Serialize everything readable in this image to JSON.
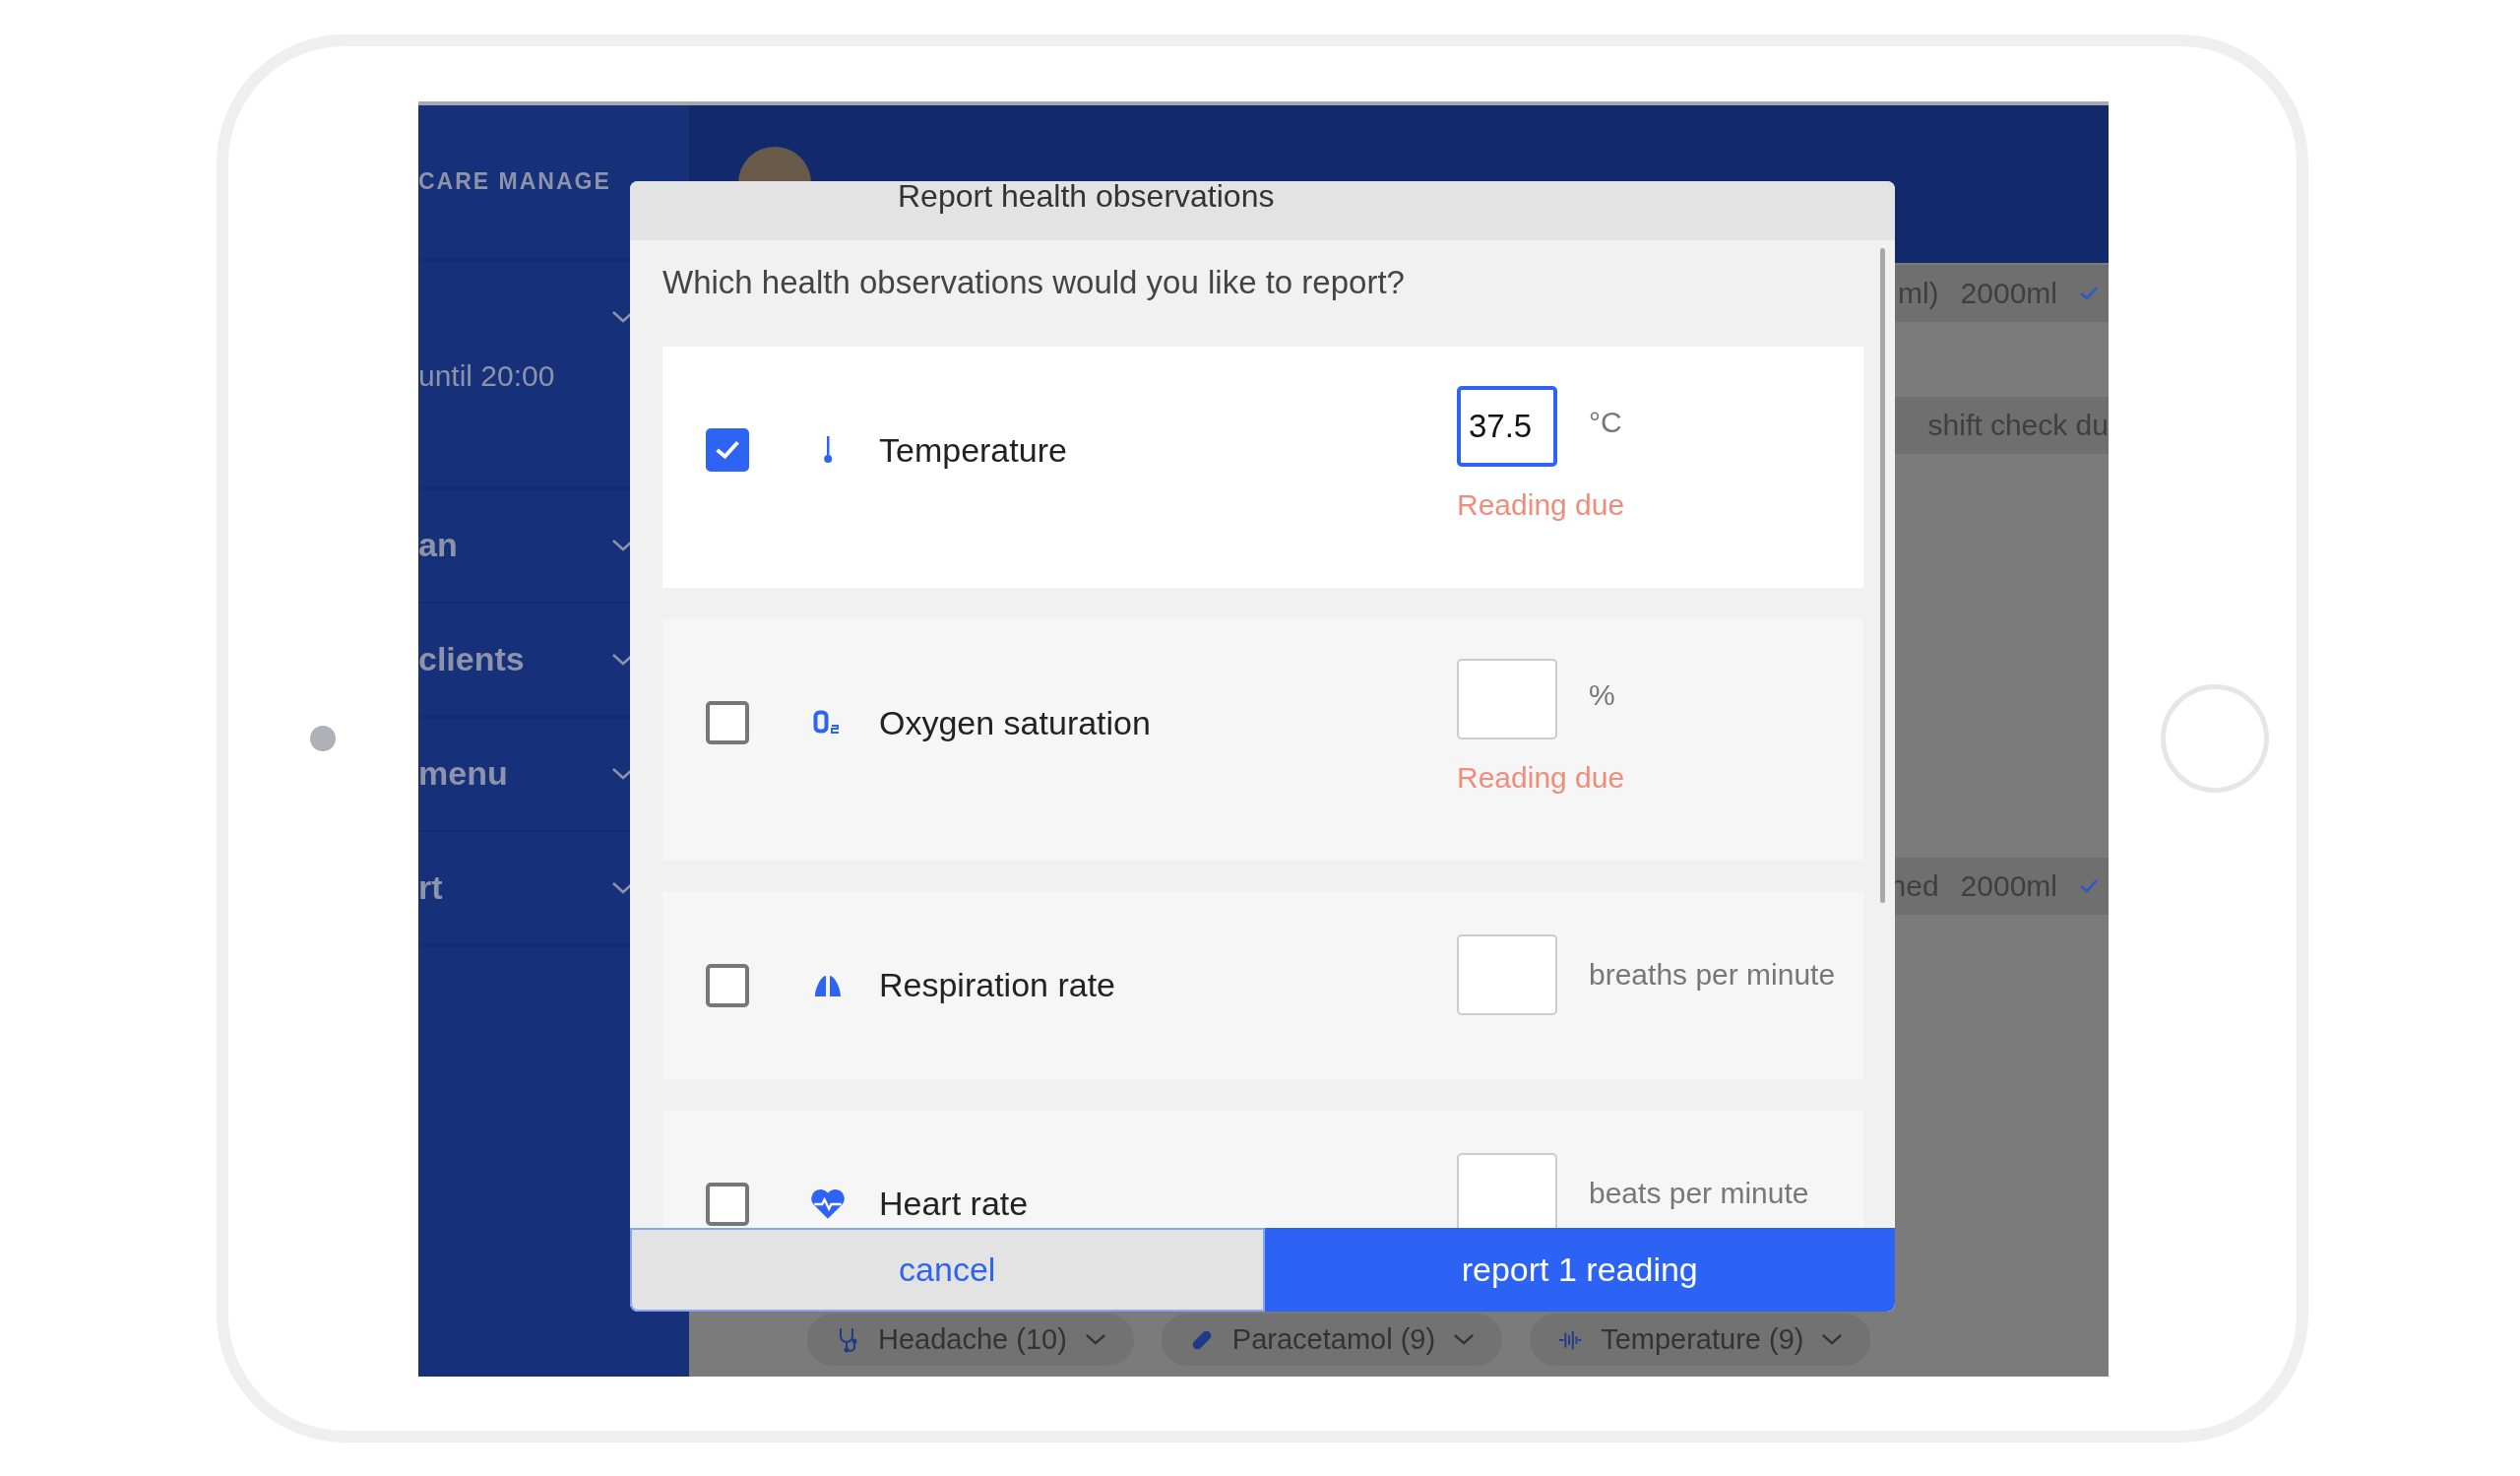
{
  "sidebar": {
    "brand": "CARE MANAGE",
    "items": [
      {
        "kind": "section",
        "detail": "until 20:00"
      },
      {
        "kind": "item",
        "label": "an"
      },
      {
        "kind": "item",
        "label": "clients"
      },
      {
        "kind": "item",
        "label": "menu"
      },
      {
        "kind": "item",
        "label": "rt"
      }
    ]
  },
  "background": {
    "rows": [
      {
        "text": "ml)",
        "amount": "2000ml",
        "done": true
      },
      {
        "text": "shift check du",
        "done": false
      },
      {
        "text": "hed",
        "amount": "2000ml",
        "done": true
      }
    ],
    "chips": [
      {
        "kind": "stethoscope",
        "label": "Headache (10)"
      },
      {
        "kind": "pill",
        "label": "Paracetamol (9)"
      },
      {
        "kind": "pulse",
        "label": "Temperature (9)"
      }
    ]
  },
  "dialog": {
    "title": "Report health observations",
    "question": "Which health observations would you like to report?",
    "observations": [
      {
        "kind": "thermometer",
        "name": "Temperature",
        "checked": true,
        "value": "37.5",
        "focused": true,
        "unit": "°C",
        "note": "Reading due"
      },
      {
        "kind": "oxygen",
        "name": "Oxygen saturation",
        "checked": false,
        "focused": false,
        "unit": "%",
        "note": "Reading due"
      },
      {
        "kind": "lungs",
        "name": "Respiration rate",
        "checked": false,
        "focused": false,
        "unit": "breaths per minute"
      },
      {
        "kind": "heart",
        "name": "Heart rate",
        "checked": false,
        "focused": false,
        "unit": "beats per minute"
      }
    ],
    "cancel": "cancel",
    "submit": "report 1 reading"
  }
}
